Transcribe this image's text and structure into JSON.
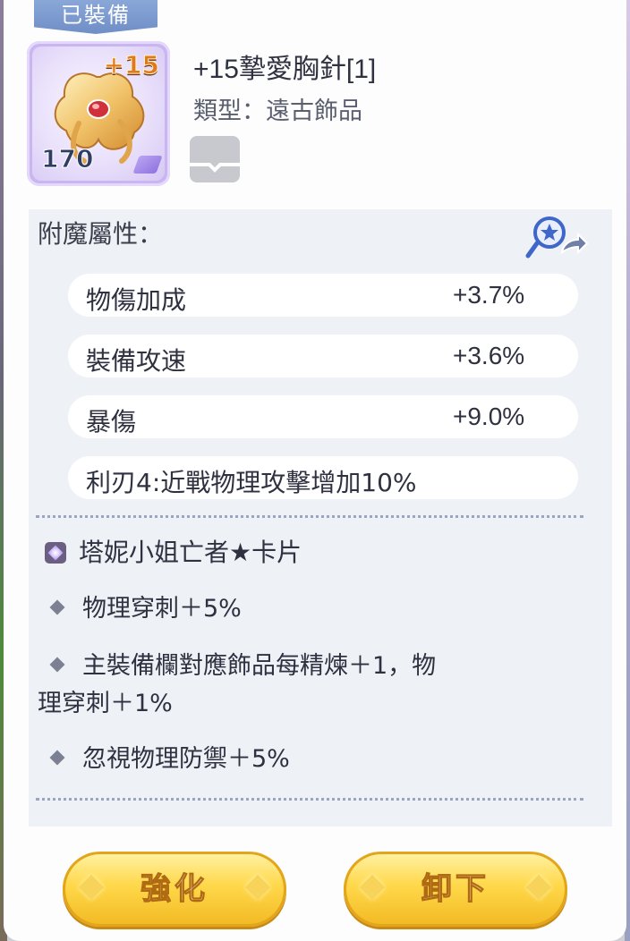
{
  "item": {
    "equipped_tag": "已裝備",
    "refine": "+15",
    "level": "170",
    "name": "+15摯愛胸針[1]",
    "type_label": "類型：遠古飾品"
  },
  "enchant": {
    "title": "附魔屬性：",
    "stats": [
      {
        "name": "物傷加成",
        "value": "+3.7%"
      },
      {
        "name": "裝備攻速",
        "value": "+3.6%"
      },
      {
        "name": "暴傷",
        "value": "+9.0%"
      }
    ],
    "extra": "利刃4:近戰物理攻擊增加10%"
  },
  "card": {
    "name": "塔妮小姐亡者★卡片",
    "effects": [
      "物理穿刺＋5%",
      "主裝備欄對應飾品每精煉＋1，物",
      "理穿刺＋1%",
      "忽視物理防禦＋5%"
    ]
  },
  "buttons": {
    "enhance": "強化",
    "unequip": "卸下"
  }
}
